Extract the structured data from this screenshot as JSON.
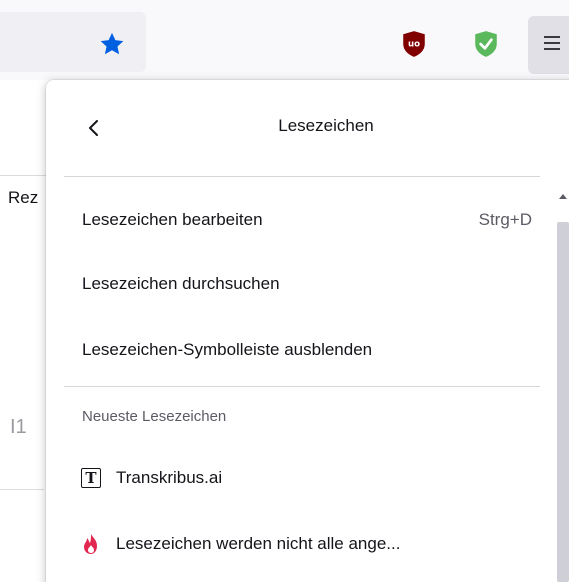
{
  "toolbar": {
    "bookmark_star_icon": "star-icon",
    "extensions": [
      "ublock-origin-icon",
      "privacy-badger-shield-icon"
    ],
    "menu_icon": "hamburger-menu-icon"
  },
  "background_page": {
    "text_top": "Rez",
    "text_mid": "I1"
  },
  "panel": {
    "title": "Lesezeichen",
    "back_label": "",
    "items": [
      {
        "label": "Lesezeichen bearbeiten",
        "shortcut": "Strg+D"
      },
      {
        "label": "Lesezeichen durchsuchen",
        "shortcut": ""
      },
      {
        "label": "Lesezeichen-Symbolleiste ausblenden",
        "shortcut": ""
      }
    ],
    "recent_section_title": "Neueste Lesezeichen",
    "recent_bookmarks": [
      {
        "label": "Transkribus.ai",
        "favicon": "T"
      },
      {
        "label": "Lesezeichen werden nicht alle ange...",
        "favicon": "flame-icon"
      }
    ]
  },
  "colors": {
    "star": "#0060df",
    "ublock": "#800000",
    "shield": "#5cb85c",
    "flame": "#e22850"
  }
}
